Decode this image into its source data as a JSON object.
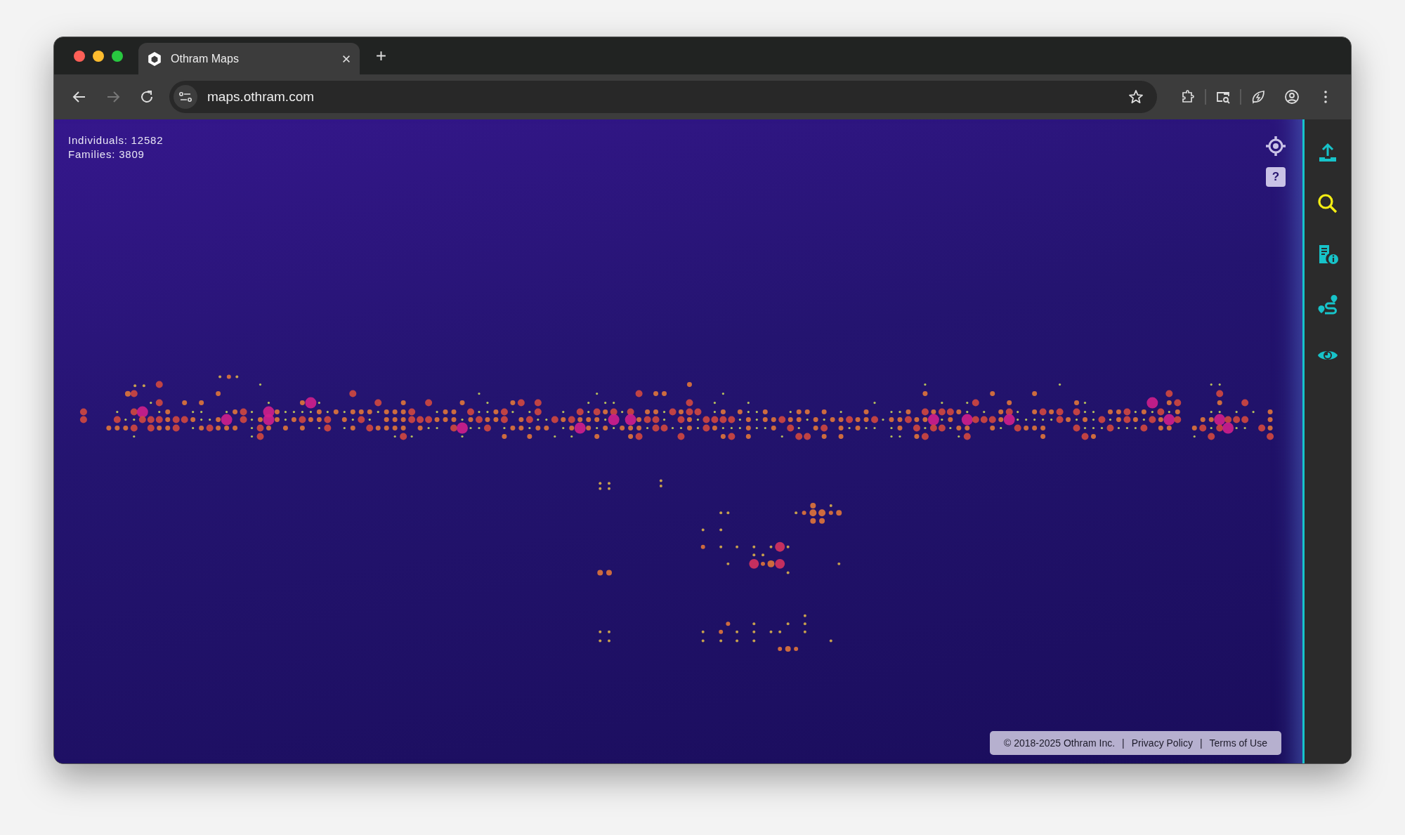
{
  "browser": {
    "tab_title": "Othram Maps",
    "url": "maps.othram.com"
  },
  "stats": [
    "Individuals: 12582",
    "Families: 3809"
  ],
  "map_controls": {
    "help_label": "?"
  },
  "sidebar": {
    "items": [
      {
        "kind": "upload",
        "selected": false
      },
      {
        "kind": "search",
        "selected": true
      },
      {
        "kind": "info",
        "selected": false
      },
      {
        "kind": "route",
        "selected": false
      },
      {
        "kind": "eye",
        "selected": false
      }
    ]
  },
  "footer": {
    "copyright": "© 2018-2025 Othram Inc.",
    "links": [
      {
        "separator": "|",
        "label": "Privacy Policy"
      },
      {
        "separator": "|",
        "label": "Terms of Use"
      }
    ]
  }
}
